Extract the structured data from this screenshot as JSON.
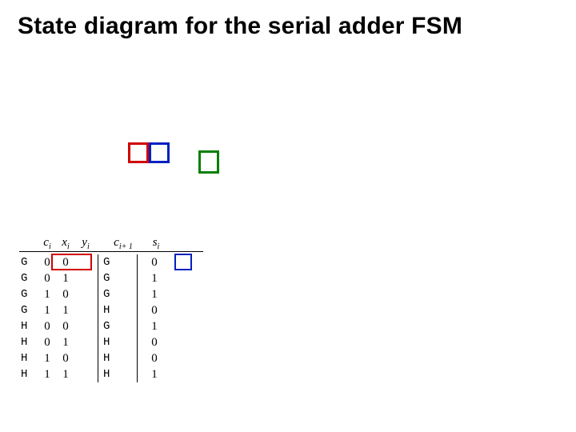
{
  "title": "State diagram for the serial adder FSM",
  "headers": {
    "ci": "c",
    "ci_sub": "i",
    "xi": "x",
    "xi_sub": "i",
    "yi": "y",
    "yi_sub": "i",
    "ci1": "c",
    "ci1_sub": "i",
    "ci1_plus": "+ 1",
    "si": "s",
    "si_sub": "i"
  },
  "col_letters_left": [
    "G",
    "G",
    "G",
    "G",
    "H",
    "H",
    "H",
    "H"
  ],
  "col_ci": [
    "0",
    "0",
    "1",
    "1",
    "0",
    "0",
    "1",
    "1"
  ],
  "col_xi": [
    "0",
    "1",
    "0",
    "1",
    "0",
    "1",
    "0",
    "1"
  ],
  "col_yi": [
    "",
    "",
    "",
    "",
    "",
    "",
    "",
    ""
  ],
  "col_letters_mid": [
    "G",
    "G",
    "G",
    "H",
    "G",
    "H",
    "H",
    "H"
  ],
  "col_ci1": [
    "",
    "",
    "",
    "",
    "",
    "",
    "",
    ""
  ],
  "col_si": [
    "0",
    "1",
    "1",
    "0",
    "1",
    "0",
    "0",
    "1"
  ],
  "boxes": {
    "b1_color": "red",
    "b2_color": "blue",
    "b3_color": "green"
  }
}
